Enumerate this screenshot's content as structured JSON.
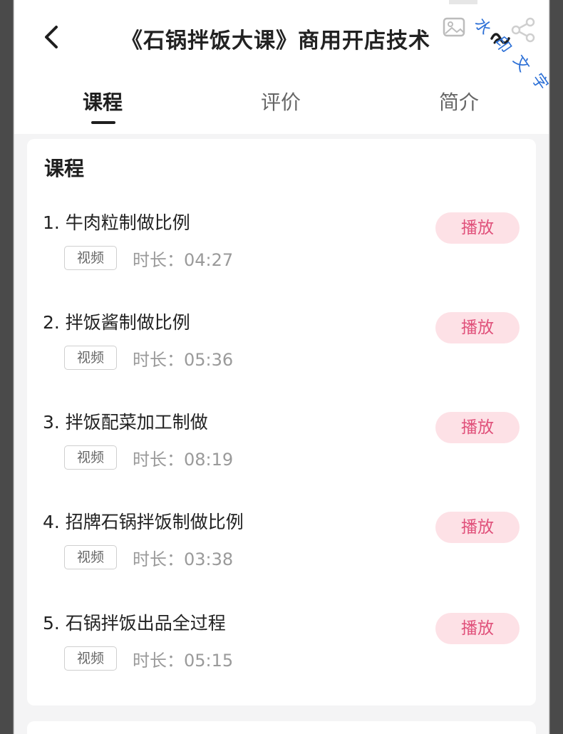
{
  "header": {
    "title": "《石锅拌饭大课》商用开店技术",
    "watermark": "水印文字"
  },
  "tabs": [
    {
      "label": "课程",
      "active": true
    },
    {
      "label": "评价",
      "active": false
    },
    {
      "label": "简介",
      "active": false
    }
  ],
  "section": {
    "title": "课程"
  },
  "lessons": [
    {
      "title": "1. 牛肉粒制做比例",
      "badge": "视频",
      "duration": "时长：04:27",
      "play_label": "播放"
    },
    {
      "title": "2. 拌饭酱制做比例",
      "badge": "视频",
      "duration": "时长：05:36",
      "play_label": "播放"
    },
    {
      "title": "3. 拌饭配菜加工制做",
      "badge": "视频",
      "duration": "时长：08:19",
      "play_label": "播放"
    },
    {
      "title": "4. 招牌石锅拌饭制做比例",
      "badge": "视频",
      "duration": "时长：03:38",
      "play_label": "播放"
    },
    {
      "title": "5. 石锅拌饭出品全过程",
      "badge": "视频",
      "duration": "时长：05:15",
      "play_label": "播放"
    }
  ],
  "colors": {
    "accent": "#e0507a",
    "play_bg": "#fde1e6",
    "page_bg": "#f4f4f5"
  },
  "icons": [
    "back-arrow-icon",
    "picture-icon",
    "share-icon",
    "audio-wave-icon"
  ]
}
